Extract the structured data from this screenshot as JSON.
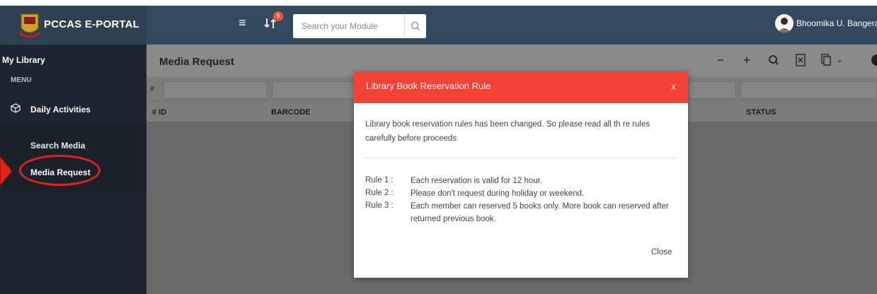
{
  "header": {
    "brand_name": "PCCAS E-PORTAL",
    "notification_count": "5",
    "search_placeholder": "Search your Module",
    "user_name": "Bhoomika U. Bangera"
  },
  "sidebar": {
    "title": "My Library",
    "menu_heading": "MENU",
    "group_label": "Daily Activities",
    "items": [
      {
        "label": "Search Media"
      },
      {
        "label": "Media Request"
      }
    ]
  },
  "content": {
    "page_title": "Media Request",
    "filter_hash": "#",
    "columns": [
      "# ID",
      "BARCODE",
      "STATUS"
    ]
  },
  "modal": {
    "title": "Library Book Reservation Rule",
    "close_x": "x",
    "intro": "Library book reservation rules has been changed. So please read all th re rules carefully before proceeds",
    "rules": [
      {
        "label": "Rule 1 :",
        "text": "Each reservation is valid for 12 hour."
      },
      {
        "label": "Rule 2 :",
        "text": "Please don't request during holiday or weekend."
      },
      {
        "label": "Rule 3 :",
        "text": "Each member can reserved 5 books only. More book can reserved after returned previous book."
      }
    ],
    "close_label": "Close"
  },
  "colors": {
    "topbar": "#34495e",
    "sidebar": "#1d2530",
    "modal_header": "#f44336",
    "badge": "#f0522e",
    "annotation": "#e2231a"
  },
  "icons": [
    "hamburger-menu-icon",
    "notification-icon",
    "search-icon",
    "chevron-down-icon",
    "cube-icon",
    "minus-icon",
    "plus-icon",
    "excel-icon",
    "copy-icon",
    "help-icon"
  ]
}
